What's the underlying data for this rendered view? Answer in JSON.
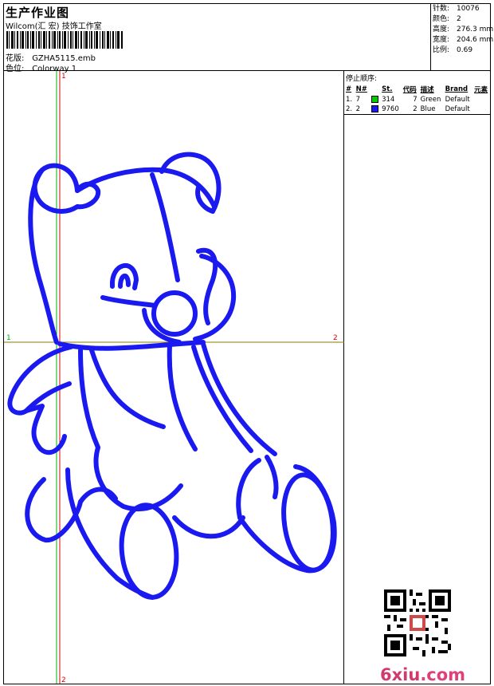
{
  "header": {
    "title": "生产作业图",
    "company": "Wilcom(汇 宏) 技饰工作室",
    "design_label": "花版:",
    "design_value": "GZHA5115.emb",
    "colorway_label": "色位:",
    "colorway_value": "Colorway 1"
  },
  "stats": [
    {
      "label": "针数:",
      "value": "10076"
    },
    {
      "label": "颜色:",
      "value": "2"
    },
    {
      "label": "高度:",
      "value": "276.3 mm"
    },
    {
      "label": "宽度:",
      "value": "204.6 mm"
    },
    {
      "label": "比例:",
      "value": "0.69"
    }
  ],
  "canvas": {
    "h_marker_left": "1",
    "h_marker_right": "2",
    "v_marker_top": "1",
    "v_marker_bottom": "2",
    "thread_color": "#1a1af0",
    "h_axis_color": "#8a7a00",
    "v_axis_color_a": "#00b000",
    "v_axis_color_b": "#e00000"
  },
  "stops": {
    "title": "停止顺序:",
    "headers": [
      "#",
      "N#",
      "St.",
      "代码",
      "描述",
      "Brand",
      "元素"
    ],
    "rows": [
      {
        "idx": "1.",
        "n": "7",
        "color": "#00cc00",
        "st": "314",
        "code": "7",
        "desc": "Green",
        "brand": "Default",
        "elem": ""
      },
      {
        "idx": "2.",
        "n": "2",
        "color": "#1a1af0",
        "st": "9760",
        "code": "2",
        "desc": "Blue",
        "brand": "Default",
        "elem": ""
      }
    ]
  },
  "watermark": {
    "prefix": "6xiu",
    "suffix": ".com",
    "brand_color": "#e0407a"
  }
}
